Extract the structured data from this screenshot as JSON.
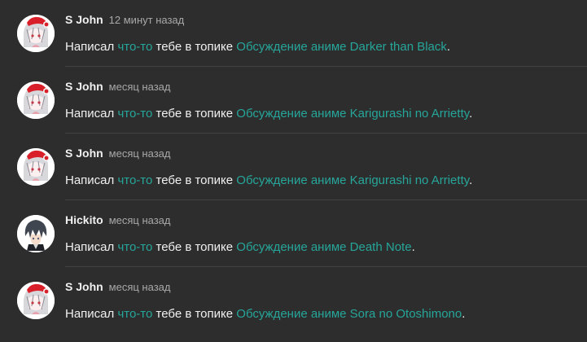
{
  "notifications": [
    {
      "author": "S John",
      "time": "12 минут назад",
      "text_prefix": "Написал",
      "something_link": "что-то",
      "text_middle": "тебе в топике",
      "topic_link": "Обсуждение аниме Darker than Black",
      "end": ".",
      "avatar": "santa-hat-girl-avatar"
    },
    {
      "author": "S John",
      "time": "месяц назад",
      "text_prefix": "Написал",
      "something_link": "что-то",
      "text_middle": "тебе в топике",
      "topic_link": "Обсуждение аниме Karigurashi no Arrietty",
      "end": ".",
      "avatar": "santa-hat-girl-avatar"
    },
    {
      "author": "S John",
      "time": "месяц назад",
      "text_prefix": "Написал",
      "something_link": "что-то",
      "text_middle": "тебе в топике",
      "topic_link": "Обсуждение аниме Karigurashi no Arrietty",
      "end": ".",
      "avatar": "santa-hat-girl-avatar"
    },
    {
      "author": "Hickito",
      "time": "месяц назад",
      "text_prefix": "Написал",
      "something_link": "что-то",
      "text_middle": "тебе в топике",
      "topic_link": "Обсуждение аниме Death Note",
      "end": ".",
      "avatar": "dark-hair-boy-avatar"
    },
    {
      "author": "S John",
      "time": "месяц назад",
      "text_prefix": "Написал",
      "something_link": "что-то",
      "text_middle": "тебе в топике",
      "topic_link": "Обсуждение аниме Sora no Otoshimono",
      "end": ".",
      "avatar": "santa-hat-girl-avatar"
    }
  ],
  "colors": {
    "background": "#2d2d2d",
    "text": "#f0f0f0",
    "muted": "#a8a8a8",
    "link": "#26a69a",
    "divider": "#434343"
  }
}
